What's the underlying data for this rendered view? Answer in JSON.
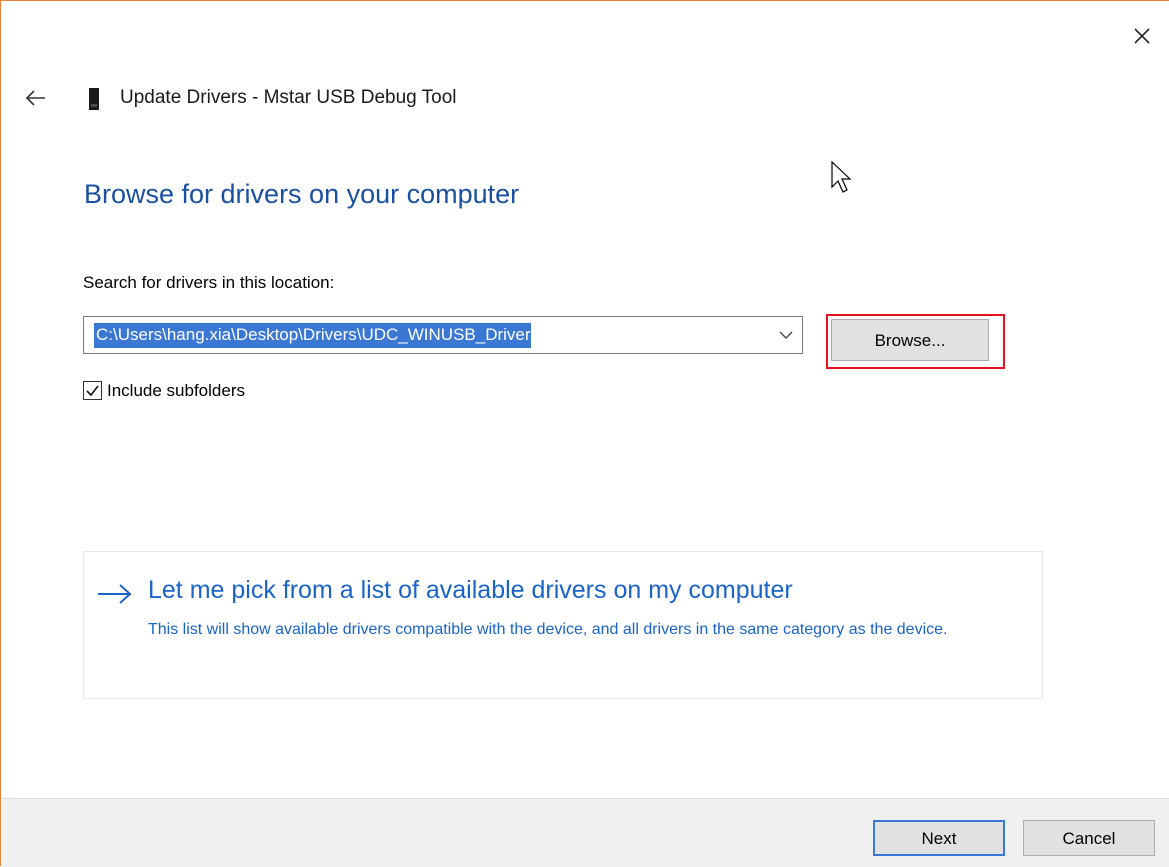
{
  "window": {
    "title": "Update Drivers - Mstar USB Debug Tool",
    "close_icon": "close-icon",
    "back_icon": "back-arrow-icon",
    "device_icon": "usb-device-icon"
  },
  "main": {
    "page_title": "Browse for drivers on your computer",
    "location_label": "Search for drivers in this location:",
    "path_value": "C:\\Users\\hang.xia\\Desktop\\Drivers\\UDC_WINUSB_Driver",
    "browse_label": "Browse...",
    "include_subfolders_label": "Include subfolders",
    "include_subfolders_checked": true
  },
  "pick_option": {
    "title": "Let me pick from a list of available drivers on my computer",
    "description": "This list will show available drivers compatible with the device, and all drivers in the same category as the device."
  },
  "footer": {
    "next_label": "Next",
    "cancel_label": "Cancel"
  },
  "colors": {
    "accent": "#1a64c8",
    "title_blue": "#1a50a0",
    "selection": "#3a78d4",
    "highlight_box": "#e81123",
    "window_border": "#e8823a"
  }
}
